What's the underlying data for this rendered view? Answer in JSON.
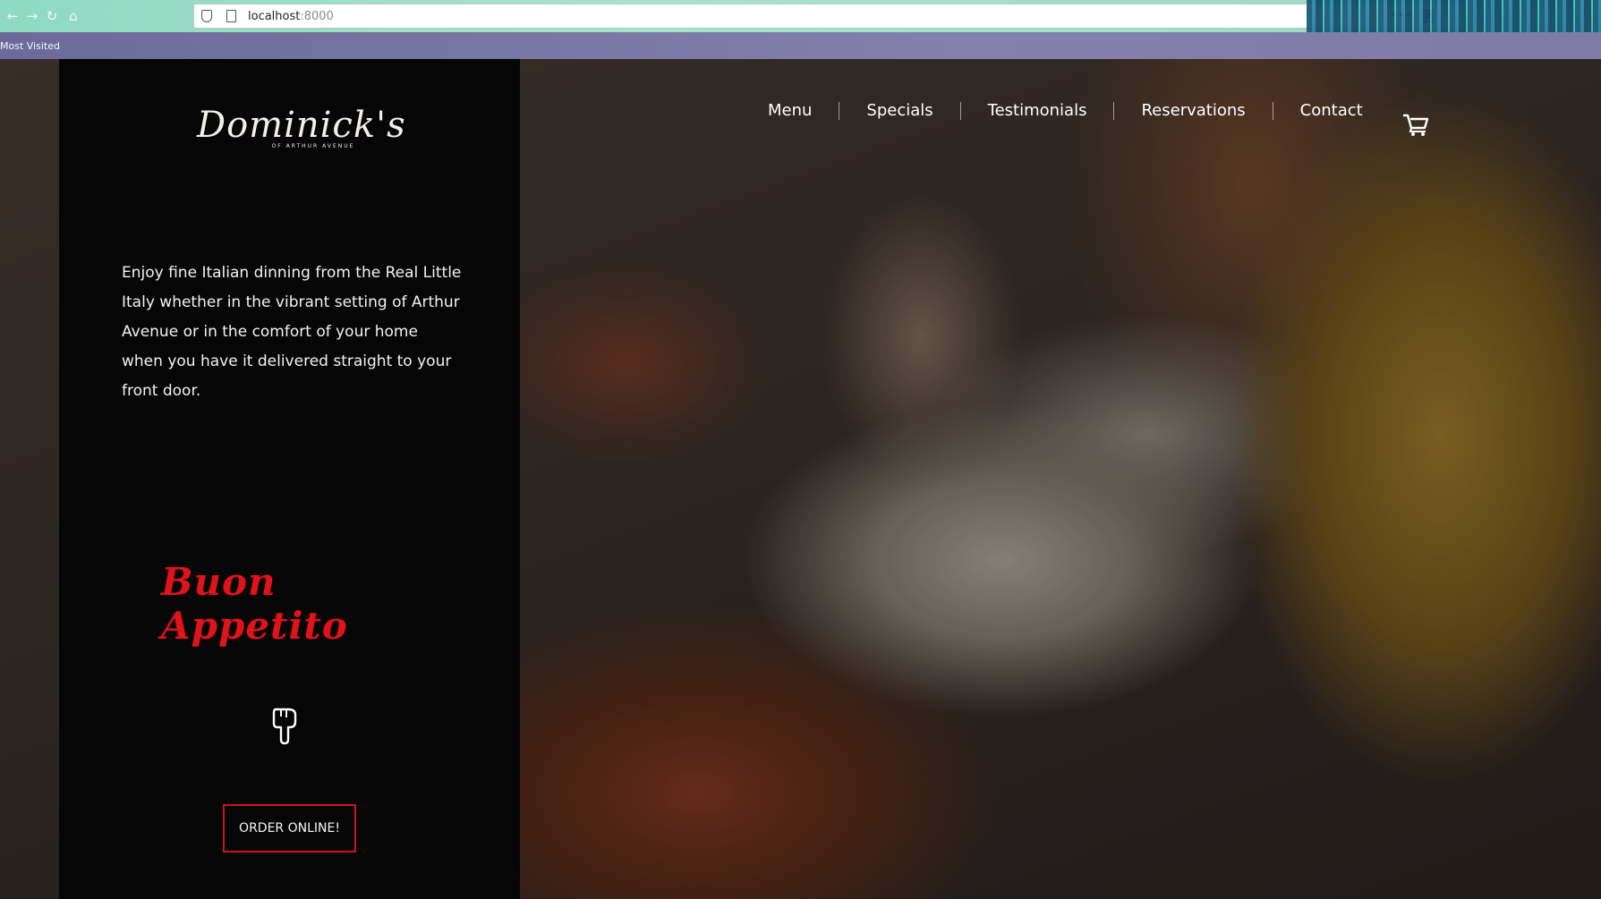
{
  "browser": {
    "url_host": "localhost",
    "url_port": ":8000",
    "bookmarks_label": "Most Visited",
    "menu_dots": "•••"
  },
  "site": {
    "logo_text": "Dominick's",
    "logo_subtitle": "OF ARTHUR AVENUE",
    "intro": "Enjoy fine Italian dinning from the Real Little Italy whether in the vibrant setting of Arthur Avenue or in the comfort of your home when you have it delivered straight to your front door.",
    "tagline": "Buon Appetito",
    "order_button": "ORDER ONLINE!",
    "nav": [
      "Menu",
      "Specials",
      "Testimonials",
      "Reservations",
      "Contact"
    ],
    "colors": {
      "accent": "#e0121a",
      "panel": "#060606",
      "text": "#ffffff"
    },
    "icons": {
      "cart": "cart-icon",
      "pointer": "hand-pointing-down-icon"
    }
  }
}
